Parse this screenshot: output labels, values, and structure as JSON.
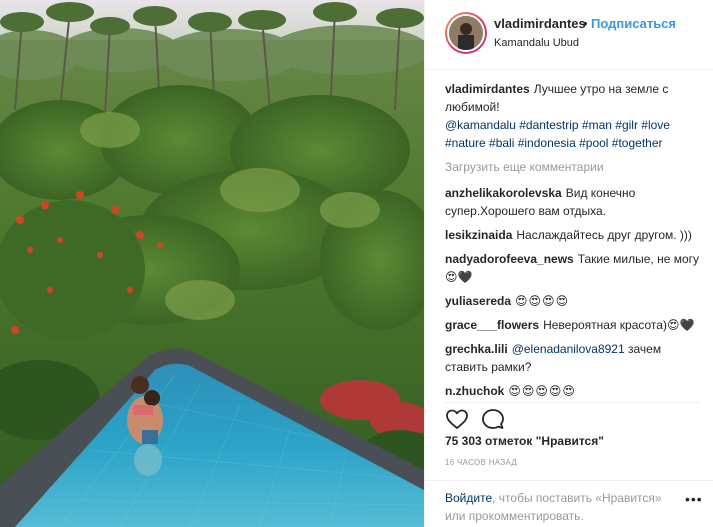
{
  "post": {
    "username": "vladimirdantes",
    "dot": "•",
    "follow_label": "Подписаться",
    "location": "Kamandalu Ubud",
    "caption_author": "vladimirdantes",
    "caption_text": "Лучшее утро на земле с любимой!",
    "caption_tags": "@kamandalu #dantestrip #man #gilr #love #nature #bali #indonesia #pool #together",
    "load_more": "Загрузить еще комментарии",
    "comments": [
      {
        "author": "anzhelikakorolevska",
        "text": "Вид конечно супер.Хорошего вам отдыха."
      },
      {
        "author": "lesikzinaida",
        "text": "Наслаждайтесь друг другом. )))"
      },
      {
        "author": "nadyadorofeeva_news",
        "text": "Такие милые, не могу 😍🖤"
      },
      {
        "author": "yuliasereda",
        "text": "😍😍😍😍"
      },
      {
        "author": "grace___flowers",
        "text": "Невероятная красота)😍🖤"
      },
      {
        "author": "grechka.lili",
        "mention": "@elenadanilova8921",
        "text": "зачем ставить рамки?"
      },
      {
        "author": "n.zhuchok",
        "text": "😍😍😍😍😍"
      }
    ],
    "likes": "75 303 отметок \"Нравится\"",
    "time": "16 ЧАСОВ НАЗАД",
    "login_link": "Войдите",
    "login_text": ", чтобы поставить «Нравится» или прокомментировать.",
    "more_label": "•••"
  },
  "icons": {
    "like": "heart-icon",
    "comment": "comment-bubble-icon"
  },
  "colors": {
    "link": "#003569",
    "follow": "#3897f0",
    "muted": "#999999"
  }
}
